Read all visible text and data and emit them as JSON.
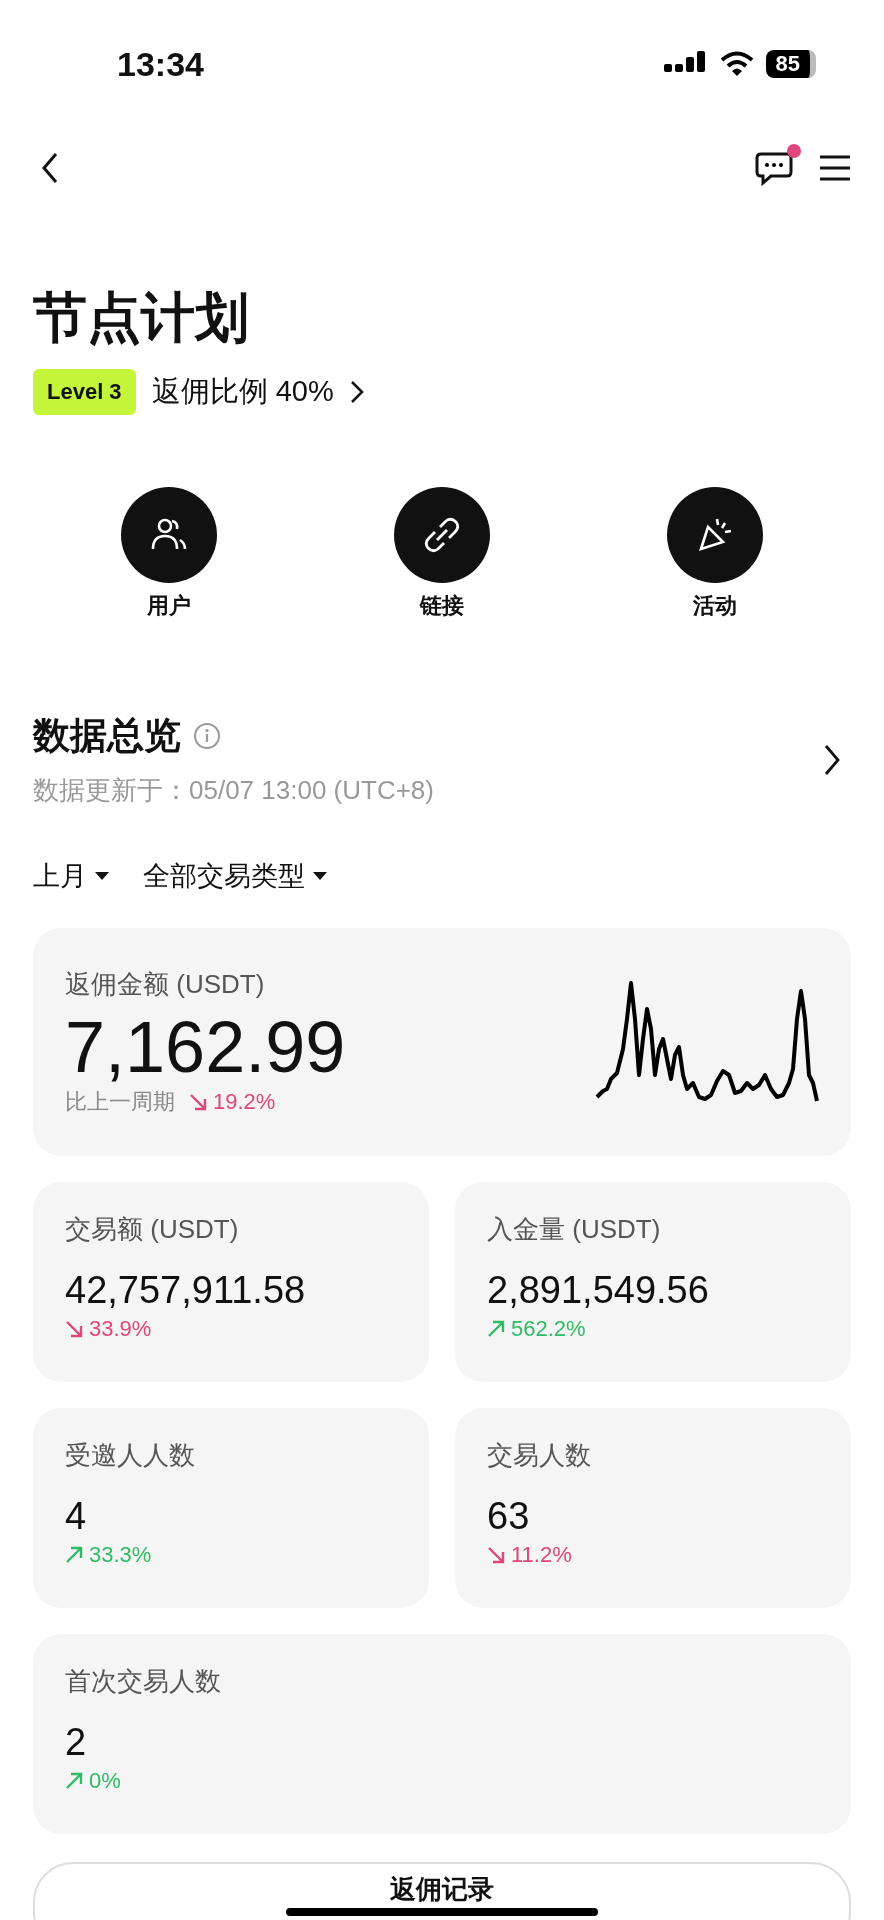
{
  "status_bar": {
    "time": "13:34",
    "battery": "85"
  },
  "nav": {
    "has_unread": true
  },
  "title": "节点计划",
  "level": {
    "badge": "Level 3",
    "rebate": "返佣比例 40%"
  },
  "shortcuts": [
    {
      "label": "用户",
      "kind": "users"
    },
    {
      "label": "链接",
      "kind": "link"
    },
    {
      "label": "活动",
      "kind": "party"
    }
  ],
  "overview": {
    "title": "数据总览",
    "updated": "数据更新于：05/07 13:00 (UTC+8)"
  },
  "filters": [
    {
      "label": "上月"
    },
    {
      "label": "全部交易类型"
    }
  ],
  "main_card": {
    "label": "返佣金额 (USDT)",
    "value": "7,162.99",
    "compare_label": "比上一周期",
    "change": "19.2%",
    "rising": false
  },
  "stats": [
    {
      "label": "交易额 (USDT)",
      "value": "42,757,911.58",
      "change": "33.9%",
      "rising": false,
      "wide": false
    },
    {
      "label": "入金量 (USDT)",
      "value": "2,891,549.56",
      "change": "562.2%",
      "rising": true,
      "wide": false
    },
    {
      "label": "受邀人人数",
      "value": "4",
      "change": "33.3%",
      "rising": true,
      "wide": false
    },
    {
      "label": "交易人数",
      "value": "63",
      "change": "11.2%",
      "rising": false,
      "wide": false
    },
    {
      "label": "首次交易人数",
      "value": "2",
      "change": "0%",
      "rising": true,
      "wide": true
    }
  ],
  "bottom_button": "返佣记录"
}
